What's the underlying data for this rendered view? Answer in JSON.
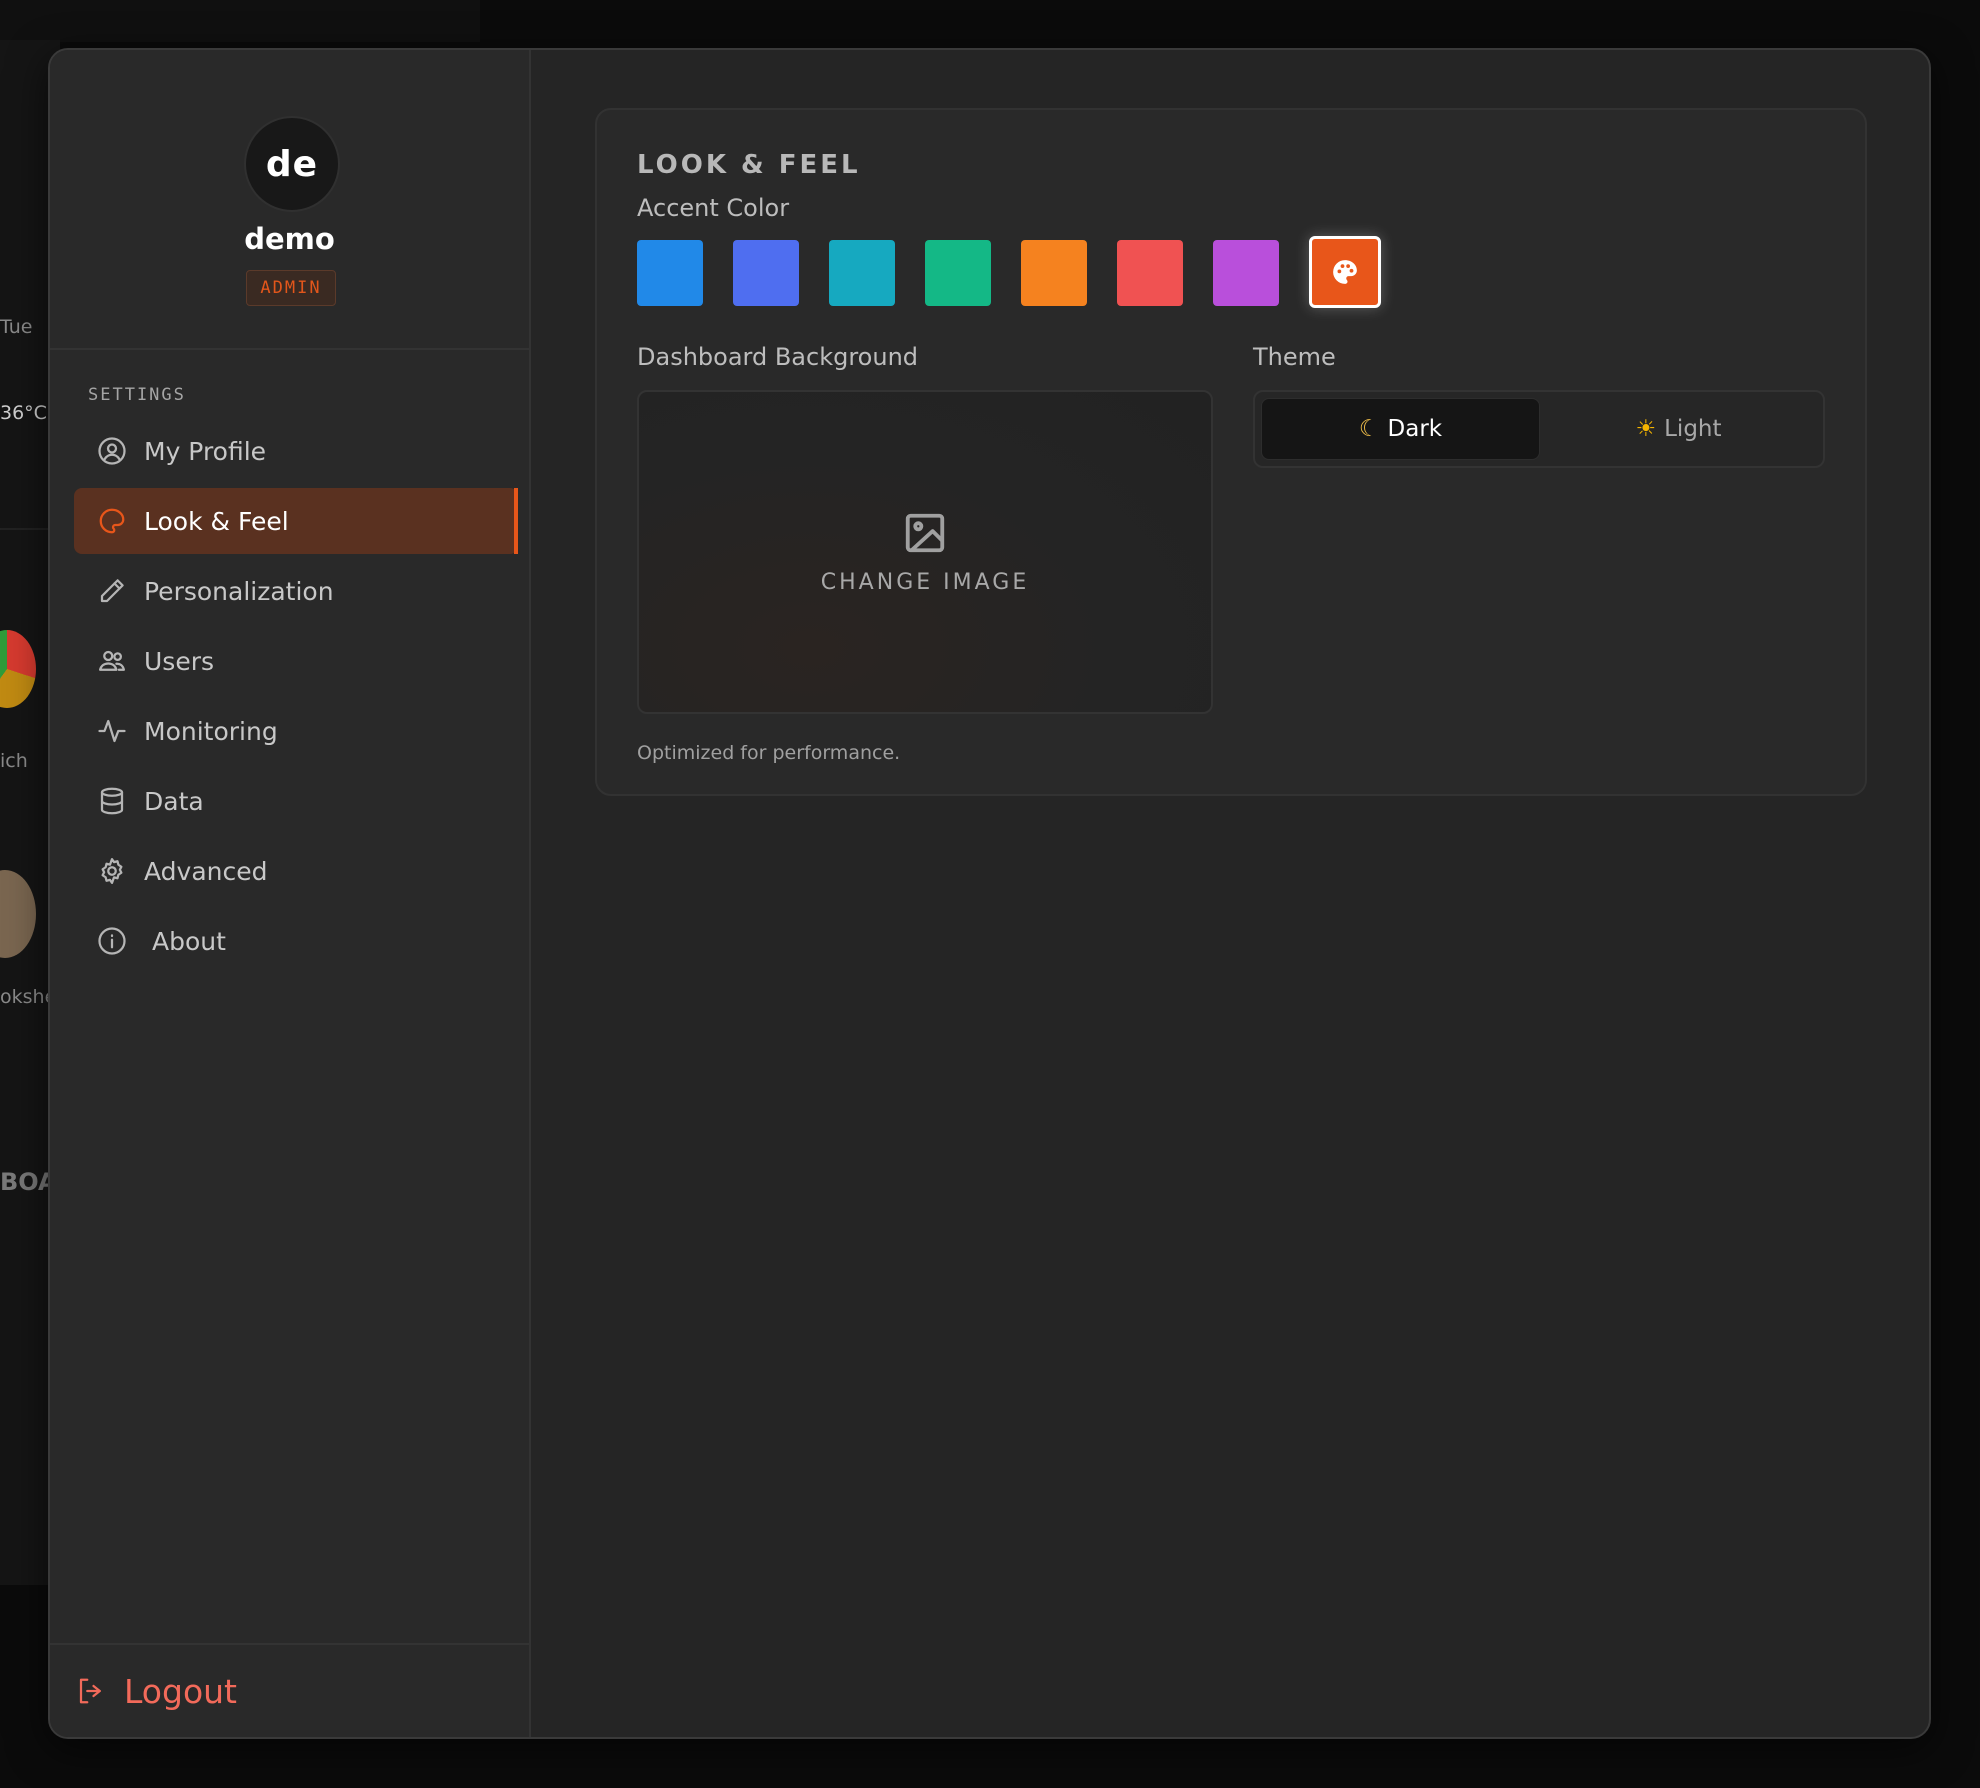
{
  "background_dashboard": {
    "weather_day": "Tue",
    "weather_temp": "36°C",
    "app_label_1": "ich",
    "app_label_2": "okshe",
    "section_label": "BOA"
  },
  "profile": {
    "avatar_initials": "de",
    "username": "demo",
    "role": "ADMIN"
  },
  "sidebar": {
    "heading": "SETTINGS",
    "items": [
      {
        "label": "My Profile",
        "icon": "user-circle-icon"
      },
      {
        "label": "Look & Feel",
        "icon": "palette-icon",
        "active": true
      },
      {
        "label": "Personalization",
        "icon": "pencil-icon"
      },
      {
        "label": "Users",
        "icon": "users-icon"
      },
      {
        "label": "Monitoring",
        "icon": "activity-icon"
      },
      {
        "label": "Data",
        "icon": "database-icon"
      },
      {
        "label": "Advanced",
        "icon": "gear-icon"
      },
      {
        "label": "About",
        "icon": "info-icon"
      }
    ],
    "logout_label": "Logout"
  },
  "look_and_feel": {
    "title": "LOOK & FEEL",
    "accent_label": "Accent Color",
    "accent_colors": [
      "#2189e8",
      "#4f6ef0",
      "#16a9c0",
      "#14b886",
      "#f5821f",
      "#f05252",
      "#b94fdb"
    ],
    "custom_accent_color": "#e8561a",
    "custom_accent_icon": "palette-icon",
    "background_label": "Dashboard Background",
    "change_image_label": "CHANGE IMAGE",
    "helper_text": "Optimized for performance.",
    "theme_label": "Theme",
    "theme_options": [
      {
        "label": "Dark",
        "icon": "moon-icon",
        "active": true
      },
      {
        "label": "Light",
        "icon": "sun-icon",
        "active": false
      }
    ]
  }
}
